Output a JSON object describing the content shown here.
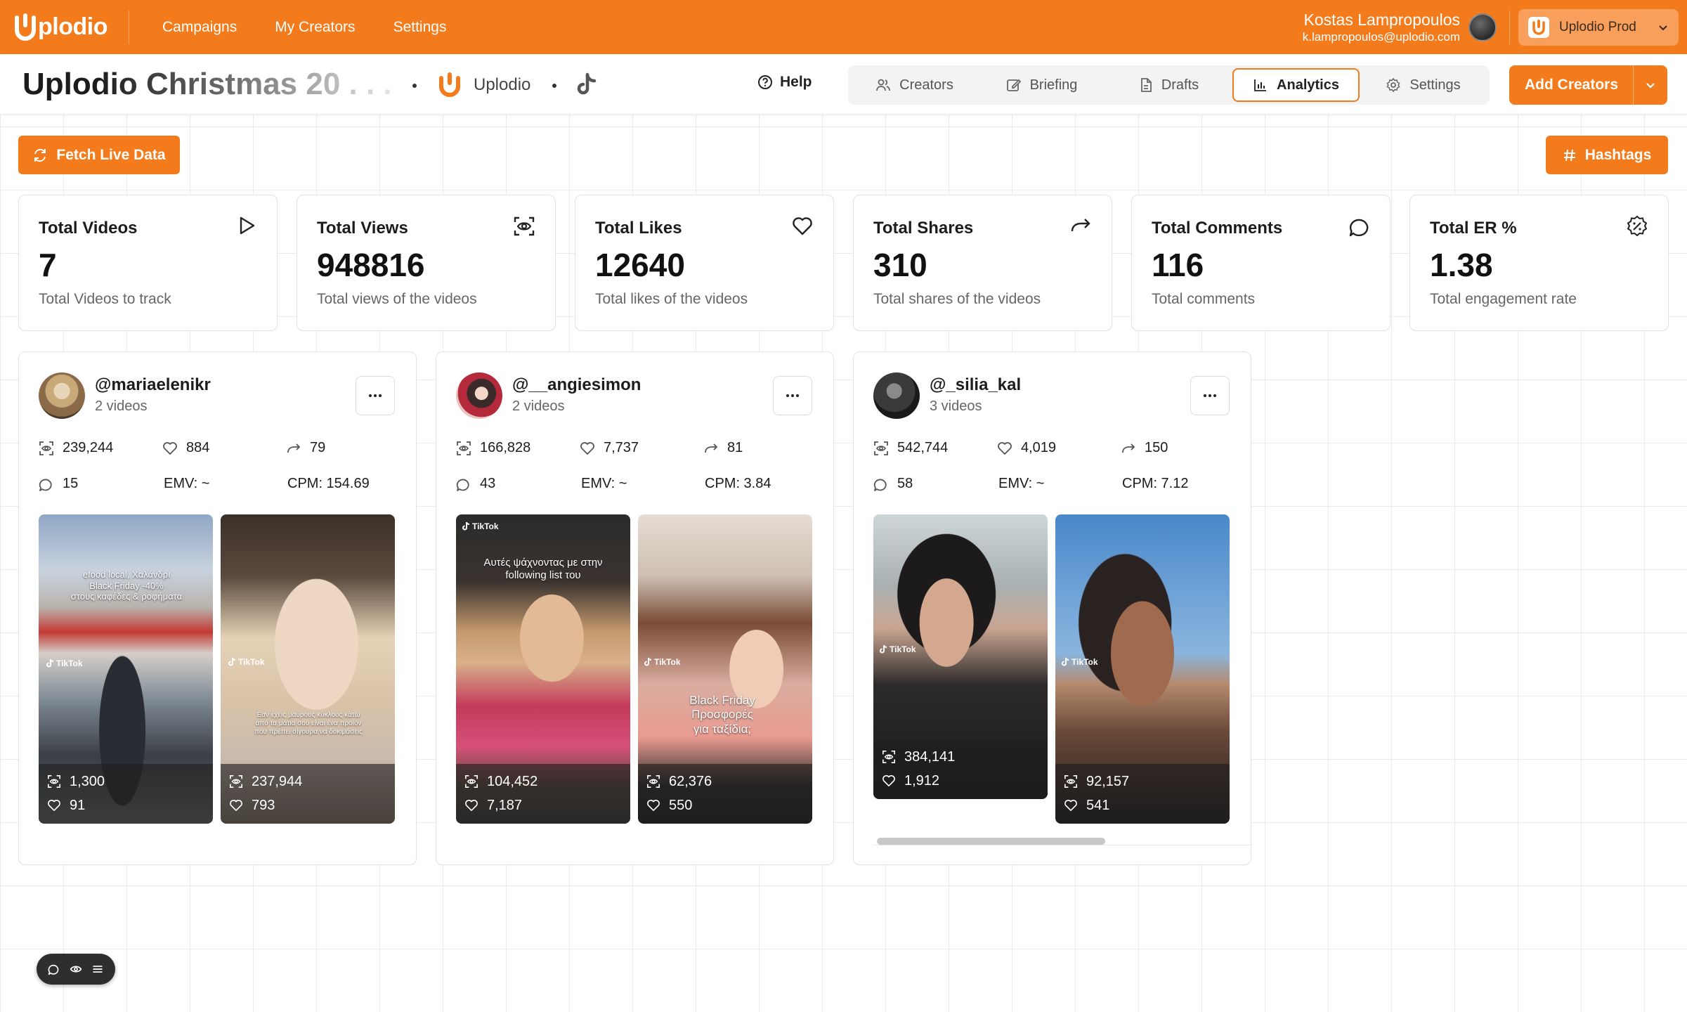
{
  "app": {
    "brand": "plodio",
    "nav": [
      "Campaigns",
      "My Creators",
      "Settings"
    ],
    "user_name": "Kostas Lampropoulos",
    "user_email": "k.lampropoulos@uplodio.com",
    "workspace": "Uplodio Prod"
  },
  "campaign": {
    "title": "Uplodio Christmas 20 . . .",
    "brand_name": "Uplodio",
    "help": "Help",
    "tabs": [
      "Creators",
      "Briefing",
      "Drafts",
      "Analytics",
      "Settings"
    ],
    "active_tab": "Analytics",
    "add_creators": "Add Creators"
  },
  "actions": {
    "fetch": "Fetch Live Data",
    "hashtags": "Hashtags"
  },
  "stats": [
    {
      "title": "Total Videos",
      "value": "7",
      "desc": "Total Videos to track",
      "icon": "play-icon"
    },
    {
      "title": "Total Views",
      "value": "948816",
      "desc": "Total views of the videos",
      "icon": "views-icon"
    },
    {
      "title": "Total Likes",
      "value": "12640",
      "desc": "Total likes of the videos",
      "icon": "heart-icon"
    },
    {
      "title": "Total Shares",
      "value": "310",
      "desc": "Total shares of the videos",
      "icon": "share-icon"
    },
    {
      "title": "Total Comments",
      "value": "116",
      "desc": "Total comments",
      "icon": "comment-icon"
    },
    {
      "title": "Total ER %",
      "value": "1.38",
      "desc": "Total engagement rate",
      "icon": "percent-badge-icon"
    }
  ],
  "creators": [
    {
      "handle": "@mariaelenikr",
      "videos_label": "2 videos",
      "views": "239,244",
      "likes": "884",
      "shares": "79",
      "comments": "15",
      "emv": "EMV: ~",
      "cpm": "CPM: 154.69",
      "videos": [
        {
          "views": "1,300",
          "likes": "91",
          "overlay": "efood local, Χαλάνδρι\nBlack Friday -40%\nστους καφέδες & ροφήματα"
        },
        {
          "views": "237,944",
          "likes": "793",
          "overlay": "Εαν έχεις μαύρους κύκλους κάτω\nαπό τα μάτια σου είναι ένα προϊόν\nπου πρέπει σίγουρα να δοκιμάσεις"
        }
      ]
    },
    {
      "handle": "@__angiesimon",
      "videos_label": "2 videos",
      "views": "166,828",
      "likes": "7,737",
      "shares": "81",
      "comments": "43",
      "emv": "EMV: ~",
      "cpm": "CPM: 3.84",
      "videos": [
        {
          "views": "104,452",
          "likes": "7,187",
          "overlay": "Αυτές ψάχνοντας με στην\nfollowing list του"
        },
        {
          "views": "62,376",
          "likes": "550",
          "overlay": "Black Friday\nΠροσφορές\nγια ταξίδια;"
        }
      ]
    },
    {
      "handle": "@_silia_kal",
      "videos_label": "3 videos",
      "views": "542,744",
      "likes": "4,019",
      "shares": "150",
      "comments": "58",
      "emv": "EMV: ~",
      "cpm": "CPM: 7.12",
      "videos": [
        {
          "views": "384,141",
          "likes": "1,912",
          "overlay": ""
        },
        {
          "views": "92,157",
          "likes": "541",
          "overlay": ""
        }
      ]
    }
  ],
  "tiktok_label": "TikTok",
  "colors": {
    "accent": "#f47b1c",
    "text": "#1c1c1c",
    "muted": "#666666"
  }
}
